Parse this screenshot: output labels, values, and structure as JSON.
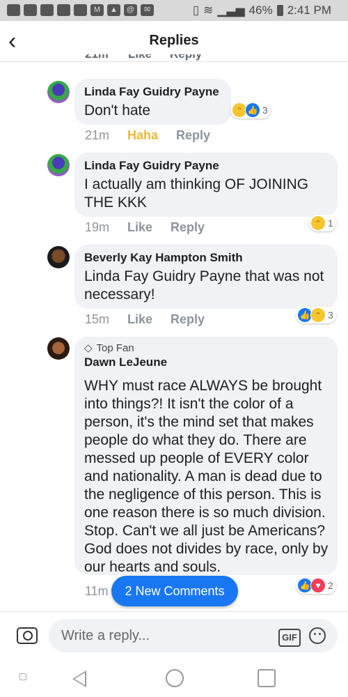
{
  "status_bar": {
    "battery": "46%",
    "time": "2:41 PM"
  },
  "header": {
    "title": "Replies",
    "back_icon": "back-arrow-icon"
  },
  "cut_off_row": {
    "time": "21m",
    "like": "Like",
    "reply": "Reply"
  },
  "comments": [
    {
      "author": "Linda Fay Guidry Payne",
      "text": "Don't hate",
      "time": "21m",
      "action1": "Haha",
      "action2": "Reply",
      "reaction_count": "3",
      "reactions": [
        "haha",
        "like"
      ]
    },
    {
      "author": "Linda Fay Guidry Payne",
      "text": "I actually am thinking OF JOINING THE KKK",
      "time": "19m",
      "action1": "Like",
      "action2": "Reply",
      "reaction_count": "1",
      "reactions": [
        "haha"
      ]
    },
    {
      "author": "Beverly Kay Hampton Smith",
      "text": "Linda Fay Guidry Payne that was not necessary!",
      "time": "15m",
      "action1": "Like",
      "action2": "Reply",
      "reaction_count": "3",
      "reactions": [
        "like",
        "haha"
      ]
    },
    {
      "badge": "Top Fan",
      "author": "Dawn LeJeune",
      "text": "WHY must race ALWAYS be brought into things?! It isn't the color of a person, it's the mind set that makes people do what they do. There are messed up people of EVERY color and nationality. A man is dead due to the negligence of this person. This is one reason there is so much division. Stop. Can't we all just be Americans? God does not divides by race, only by our hearts and souls.",
      "time": "11m",
      "reaction_count": "2",
      "reactions": [
        "like",
        "love"
      ]
    }
  ],
  "new_comments_button": "2 New Comments",
  "composer": {
    "placeholder": "Write a reply...",
    "gif_label": "GIF"
  },
  "colors": {
    "accent": "#1877f2",
    "bubble": "#f0f2f5",
    "haha_text": "#f0b93a"
  }
}
